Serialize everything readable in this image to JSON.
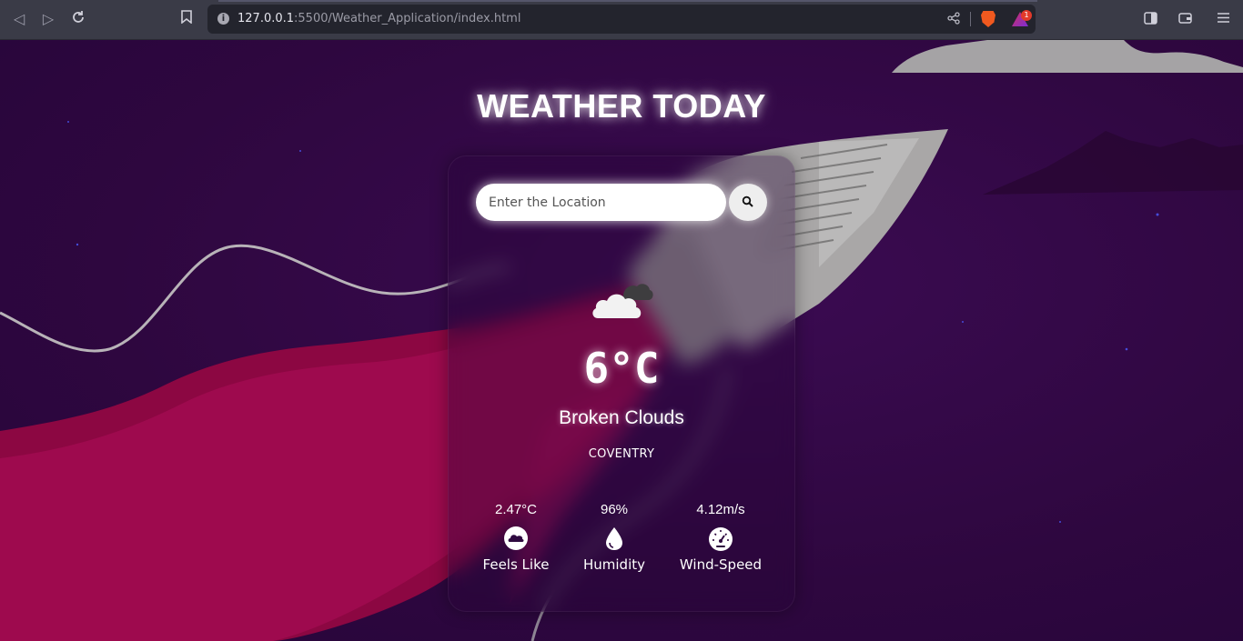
{
  "browser": {
    "url_host": "127.0.0.1",
    "url_path": ":5500/Weather_Application/index.html",
    "rewards_badge": "1"
  },
  "app": {
    "title": "WEATHER TODAY",
    "search": {
      "placeholder": "Enter the Location",
      "value": ""
    },
    "current": {
      "icon": "broken-clouds-icon",
      "temperature": "6°C",
      "description": "Broken Clouds",
      "city": "COVENTRY"
    },
    "stats": [
      {
        "value": "2.47°C",
        "label": "Feels Like",
        "icon": "cloud-circle-icon"
      },
      {
        "value": "96%",
        "label": "Humidity",
        "icon": "water-drop-icon"
      },
      {
        "value": "4.12m/s",
        "label": "Wind-Speed",
        "icon": "speedometer-icon"
      }
    ]
  },
  "colors": {
    "background": "#2f0a40",
    "trail": "#9c0745",
    "rocket": "#a8a6a6",
    "text": "#ffffff"
  }
}
